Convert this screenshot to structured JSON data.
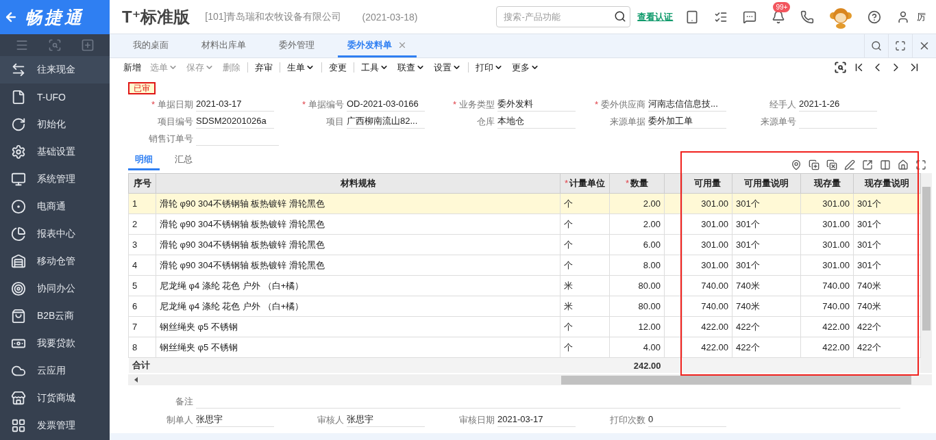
{
  "sidebar": {
    "logo": "畅捷通",
    "items": [
      {
        "label": "往来现金",
        "selected": true
      },
      {
        "label": "T-UFO",
        "selected": false
      },
      {
        "label": "初始化",
        "selected": false
      },
      {
        "label": "基础设置",
        "selected": false
      },
      {
        "label": "系统管理",
        "selected": false
      },
      {
        "label": "电商通",
        "selected": false
      },
      {
        "label": "报表中心",
        "selected": false
      },
      {
        "label": "移动仓管",
        "selected": false
      },
      {
        "label": "协同办公",
        "selected": false
      },
      {
        "label": "B2B云商",
        "selected": false
      },
      {
        "label": "我要贷款",
        "selected": false
      },
      {
        "label": "云应用",
        "selected": false
      },
      {
        "label": "订货商城",
        "selected": false
      },
      {
        "label": "发票管理",
        "selected": false
      }
    ]
  },
  "header": {
    "product": "T⁺标准版",
    "company": "[101]青岛瑞和农牧设备有限公司",
    "date": "(2021-03-18)",
    "search": {
      "placeholder": "搜索-产品功能"
    },
    "cert_link": "查看认证",
    "notification_badge": "99+",
    "user": "厉"
  },
  "tabs": [
    {
      "label": "我的桌面",
      "selected": false,
      "closable": false
    },
    {
      "label": "材料出库单",
      "selected": false,
      "closable": false
    },
    {
      "label": "委外管理",
      "selected": false,
      "closable": false
    },
    {
      "label": "委外发料单",
      "selected": true,
      "closable": true
    }
  ],
  "toolbar": [
    {
      "label": "新增",
      "disabled": false,
      "dropdown": false,
      "divider": false
    },
    {
      "label": "选单",
      "disabled": true,
      "dropdown": true,
      "divider": false
    },
    {
      "label": "保存",
      "disabled": true,
      "dropdown": true,
      "divider": false
    },
    {
      "label": "删除",
      "disabled": true,
      "dropdown": false,
      "divider": true
    },
    {
      "label": "弃审",
      "disabled": false,
      "dropdown": false,
      "divider": true
    },
    {
      "label": "生单",
      "disabled": false,
      "dropdown": true,
      "divider": true
    },
    {
      "label": "变更",
      "disabled": false,
      "dropdown": false,
      "divider": true
    },
    {
      "label": "工具",
      "disabled": false,
      "dropdown": true,
      "divider": false
    },
    {
      "label": "联查",
      "disabled": false,
      "dropdown": true,
      "divider": false
    },
    {
      "label": "设置",
      "disabled": false,
      "dropdown": true,
      "divider": true
    },
    {
      "label": "打印",
      "disabled": false,
      "dropdown": true,
      "divider": false
    },
    {
      "label": "更多",
      "disabled": false,
      "dropdown": true,
      "divider": false
    }
  ],
  "status": "已审",
  "form": [
    [
      {
        "required_mark": "*",
        "label": "单据日期",
        "value": "2021-03-17"
      },
      {
        "required_mark": "*",
        "label": "单据编号",
        "value": "OD-2021-03-0166"
      },
      {
        "required_mark": "*",
        "label": "业务类型",
        "value": "委外发料"
      },
      {
        "required_mark": "*",
        "label": "委外供应商",
        "value": "河南志信信息技..."
      },
      {
        "label": "经手人",
        "value": "2021-1-26"
      }
    ],
    [
      {
        "label": "项目编号",
        "value": "SDSM20201026a"
      },
      {
        "label": "项目",
        "value": "广西柳南流山82..."
      },
      {
        "label": "仓库",
        "value": "本地仓"
      },
      {
        "label": "来源单据",
        "value": "委外加工单"
      },
      {
        "label": "来源单号"
      }
    ],
    [
      {
        "label": "销售订单号"
      }
    ]
  ],
  "detail_tabs": [
    {
      "label": "明细",
      "selected": true
    },
    {
      "label": "汇总",
      "selected": false
    }
  ],
  "table": {
    "columns": [
      {
        "kind": "text",
        "label": "序号"
      },
      {
        "kind": "text",
        "label": "材料规格"
      },
      {
        "kind": "text",
        "required_mark": "*",
        "label": "计量单位"
      },
      {
        "kind": "number",
        "required_mark": "*",
        "label": "数量"
      },
      {
        "kind": "spacer"
      },
      {
        "kind": "number",
        "label": "可用量"
      },
      {
        "kind": "text",
        "label": "可用量说明"
      },
      {
        "kind": "number",
        "label": "现存量"
      },
      {
        "kind": "text",
        "label": "现存量说明"
      }
    ],
    "rows": [
      {
        "selected": true,
        "cells": [
          "1",
          "滑轮 φ90 304不锈钢轴 板热镀锌 滑轮黑色",
          "个",
          "2.00",
          "",
          "301.00",
          "301个",
          "301.00",
          "301个"
        ]
      },
      {
        "selected": false,
        "cells": [
          "2",
          "滑轮 φ90 304不锈钢轴 板热镀锌 滑轮黑色",
          "个",
          "2.00",
          "",
          "301.00",
          "301个",
          "301.00",
          "301个"
        ]
      },
      {
        "selected": false,
        "cells": [
          "3",
          "滑轮 φ90 304不锈钢轴 板热镀锌 滑轮黑色",
          "个",
          "6.00",
          "",
          "301.00",
          "301个",
          "301.00",
          "301个"
        ]
      },
      {
        "selected": false,
        "cells": [
          "4",
          "滑轮 φ90 304不锈钢轴 板热镀锌 滑轮黑色",
          "个",
          "8.00",
          "",
          "301.00",
          "301个",
          "301.00",
          "301个"
        ]
      },
      {
        "selected": false,
        "cells": [
          "5",
          "尼龙绳 φ4 涤纶 花色 户外 （白+橘）",
          "米",
          "80.00",
          "",
          "740.00",
          "740米",
          "740.00",
          "740米"
        ]
      },
      {
        "selected": false,
        "cells": [
          "6",
          "尼龙绳 φ4 涤纶 花色 户外 （白+橘）",
          "米",
          "80.00",
          "",
          "740.00",
          "740米",
          "740.00",
          "740米"
        ]
      },
      {
        "selected": false,
        "cells": [
          "7",
          "钢丝绳夹 φ5 不锈钢",
          "个",
          "12.00",
          "",
          "422.00",
          "422个",
          "422.00",
          "422个"
        ]
      },
      {
        "selected": false,
        "cells": [
          "8",
          "钢丝绳夹 φ5 不锈钢",
          "个",
          "4.00",
          "",
          "422.00",
          "422个",
          "422.00",
          "422个"
        ]
      }
    ],
    "total_label": "合计",
    "total_quantity": "242.00"
  },
  "remarks": {
    "label": "备注"
  },
  "footer_fields": [
    {
      "label": "制单人",
      "value": "张思宇"
    },
    {
      "label": "审核人",
      "value": "张思宇"
    },
    {
      "label": "审核日期",
      "value": "2021-03-17"
    },
    {
      "label": "打印次数",
      "value": "0"
    }
  ]
}
